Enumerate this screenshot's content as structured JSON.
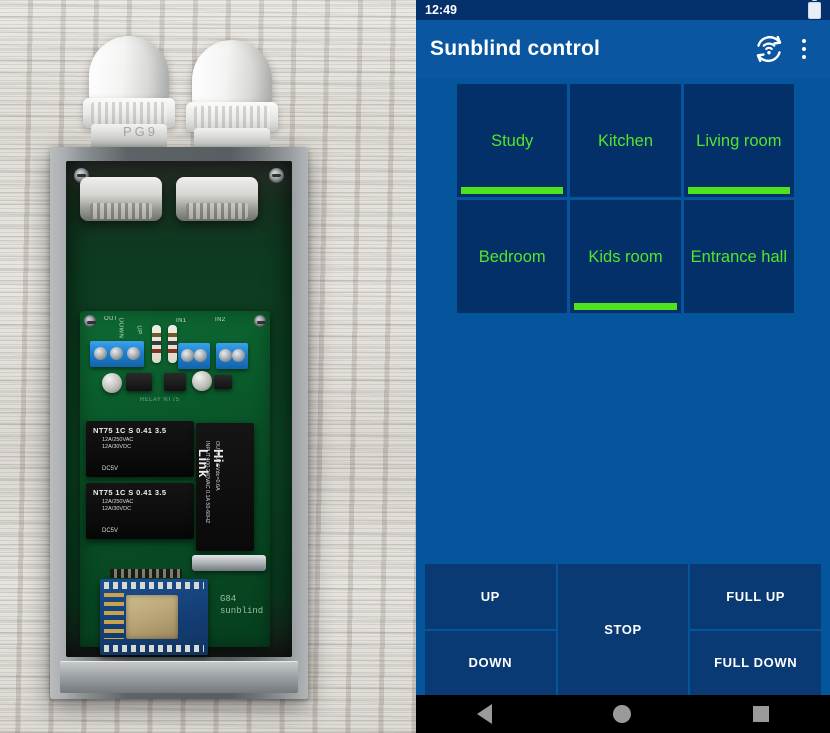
{
  "photo": {
    "description": "Sunblind controller PCB in aluminium enclosure on wooden background",
    "gland_label": "PG9",
    "pcb_label": "G84\nsunblind",
    "silkscreen": {
      "out": "OUT",
      "in1": "IN1",
      "in2": "IN2",
      "down": "DOWN",
      "up": "UP",
      "n1": "N",
      "n2": "N",
      "relay_hint": "RELAY NT75"
    },
    "relays": [
      {
        "model": "NT75  1C  S  0.41  3.5",
        "rating1": "12A/250VAC",
        "rating2": "12A/30VDC",
        "coil": "DC5V"
      },
      {
        "model": "NT75  1C  S  0.41  3.5",
        "rating1": "12A/250VAC",
        "rating2": "12A/30VDC",
        "coil": "DC5V"
      }
    ],
    "psu": {
      "brand": "Hi-Link",
      "input": "INPUT:100-240VAC  0.1A  50-60HZ",
      "output": "OUTPUT:5Vdc=0.6A",
      "pn": "P/N: HLK-PM01  3W"
    }
  },
  "statusbar": {
    "time": "12:49",
    "battery_icon": "battery-icon"
  },
  "appbar": {
    "title": "Sunblind control",
    "sync_icon": "wifi-sync-icon",
    "overflow_icon": "overflow-menu-icon"
  },
  "rooms": [
    {
      "label": "Study",
      "active": true
    },
    {
      "label": "Kitchen",
      "active": false
    },
    {
      "label": "Living room",
      "active": true
    },
    {
      "label": "Bedroom",
      "active": false
    },
    {
      "label": "Kids room",
      "active": true
    },
    {
      "label": "Entrance hall",
      "active": false
    }
  ],
  "controls": {
    "up": "UP",
    "down": "DOWN",
    "stop": "STOP",
    "full_up": "FULL UP",
    "full_down": "FULL DOWN"
  },
  "navbar": {
    "back": "back-icon",
    "home": "home-icon",
    "recents": "recents-icon"
  },
  "colors": {
    "background": "#05559C",
    "tile": "#043069",
    "accent_green": "#4FE31F",
    "appbar": "#0A56A0",
    "statusbar": "#04306B",
    "button": "#0A3A74",
    "navbar": "#000000"
  }
}
